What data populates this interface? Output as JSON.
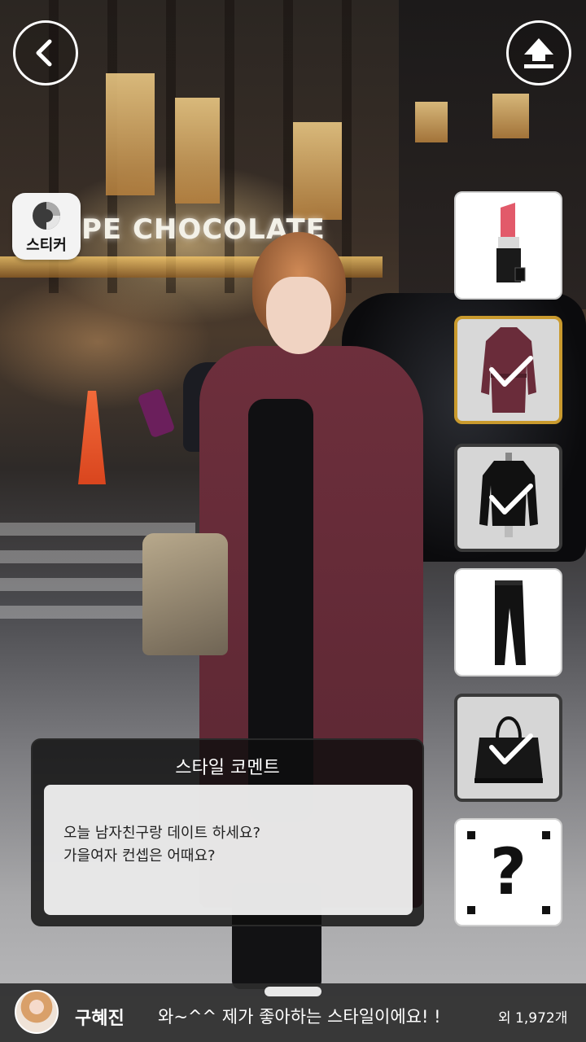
{
  "top_bar": {
    "back_icon": "chevron-left-icon",
    "upload_icon": "upload-arrow-icon"
  },
  "sticker": {
    "label": "스티커",
    "icon": "page-curl-icon"
  },
  "scene": {
    "store_sign": "PE CHOCOLATE"
  },
  "items": [
    {
      "name": "lipstick",
      "icon": "lipstick-icon",
      "selected": false,
      "checked": false
    },
    {
      "name": "burgundy-trench-coat",
      "icon": "trench-coat-icon",
      "selected": true,
      "checked": true
    },
    {
      "name": "black-top",
      "icon": "black-top-icon",
      "selected": false,
      "checked": true
    },
    {
      "name": "black-jeans",
      "icon": "jeans-icon",
      "selected": false,
      "checked": false
    },
    {
      "name": "black-tote-bag",
      "icon": "handbag-icon",
      "selected": false,
      "checked": true
    },
    {
      "name": "mystery-item",
      "icon": "question-mark-icon",
      "selected": false,
      "checked": false
    }
  ],
  "style_comment": {
    "title": "스타일 코멘트",
    "line1": "오늘 남자친구랑 데이트 하세요?",
    "line2": "가을여자 컨셉은 어때요?"
  },
  "mystery_label": "?",
  "bottom_bar": {
    "user_name": "구혜진",
    "message": "와~^^ 제가 좋아하는 스타일이에요! !",
    "count": "외 1,972개"
  },
  "colors": {
    "selected_border": "#c99a2e",
    "bar_bg": "#2d2d2d"
  }
}
